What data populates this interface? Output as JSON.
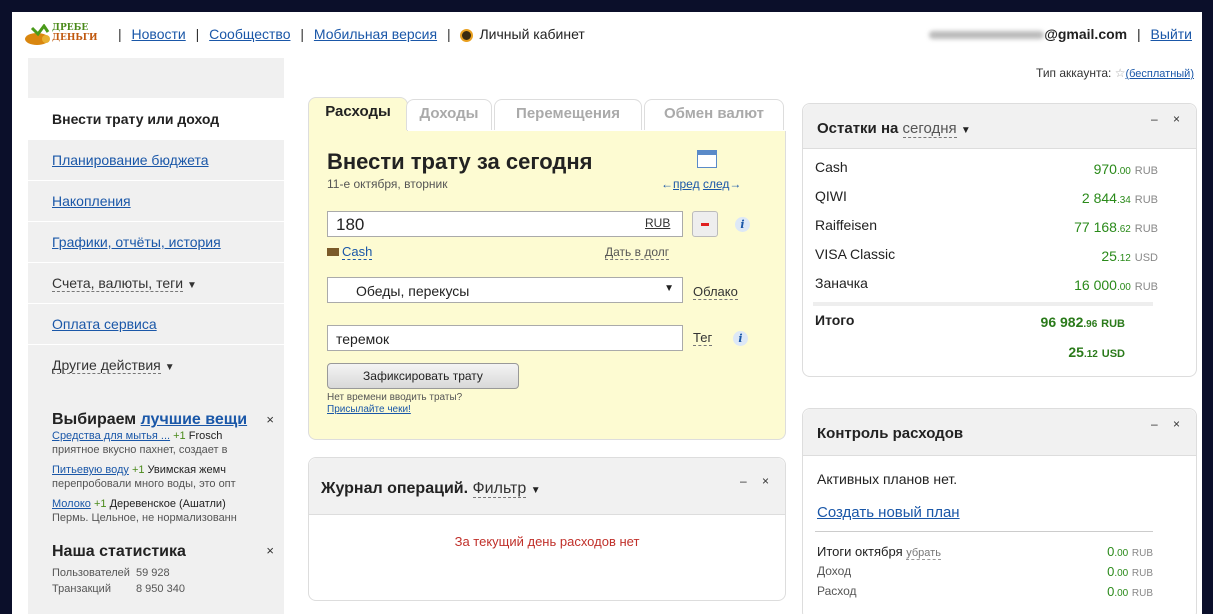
{
  "header": {
    "logo_line1": "ДРЕБЕ",
    "logo_line2": "ДЕНЬГИ",
    "nav": [
      "Новости",
      "Сообщество",
      "Мобильная версия"
    ],
    "cabinet": "Личный кабинет",
    "email": "@gmail.com",
    "logout": "Выйти"
  },
  "account": {
    "label": "Тип аккаунта:",
    "type": "(бесплатный)"
  },
  "sidebar": {
    "items": [
      {
        "label": "Внести трату или доход"
      },
      {
        "label": "Планирование бюджета"
      },
      {
        "label": "Накопления"
      },
      {
        "label": "Графики, отчёты, история"
      },
      {
        "label": "Счета, валюты, теги"
      },
      {
        "label": "Оплата сервиса"
      },
      {
        "label": "Другие действия"
      }
    ],
    "promo": {
      "title_prefix": "Выбираем",
      "title_link": "лучшие вещи",
      "close": "×",
      "entries": [
        {
          "link": "Средства для мытья ...",
          "plus": "+1",
          "text1": "Frosch",
          "text2": "приятное вкусно пахнет, создает в"
        },
        {
          "link": "Питьевую воду",
          "plus": "+1",
          "text1": "Увимская жемч",
          "text2": "перепробовали много воды, это опт"
        },
        {
          "link": "Молоко",
          "plus": "+1",
          "text1": "Деревенское (Ашатли)",
          "text2": "Пермь. Цельное, не нормализованн"
        }
      ]
    },
    "stats": {
      "title": "Наша статистика",
      "close": "×",
      "rows": [
        {
          "label": "Пользователей",
          "value": "59 928"
        },
        {
          "label": "Транзакций",
          "value": "8 950 340"
        }
      ]
    }
  },
  "entry": {
    "tabs": [
      "Расходы",
      "Доходы",
      "Перемещения",
      "Обмен валют"
    ],
    "title": "Внести трату за сегодня",
    "date": "11-е октября, вторник",
    "prev": "пред",
    "next": "след",
    "prev_arrow": "←",
    "next_arrow": "→",
    "amount": "180",
    "currency": "RUB",
    "wallet": "Cash",
    "debt": "Дать в долг",
    "category": "Обеды, перекусы",
    "cloud": "Облако",
    "tag_value": "теремок",
    "tag_label": "Тег",
    "submit": "Зафиксировать трату",
    "note1": "Нет времени вводить траты?",
    "note2": "Присылайте чеки!",
    "info": "i"
  },
  "journal": {
    "title": "Журнал операций.",
    "filter": "Фильтр",
    "empty": "За текущий день расходов нет",
    "controls": "– ×"
  },
  "balances": {
    "title": "Остатки на",
    "period": "сегодня",
    "controls": "– ×",
    "rows": [
      {
        "name": "Cash",
        "int": "970",
        "cents": ".00",
        "cur": "RUB"
      },
      {
        "name": "QIWI",
        "int": "2 844",
        "cents": ".34",
        "cur": "RUB"
      },
      {
        "name": "Raiffeisen",
        "int": "77 168",
        "cents": ".62",
        "cur": "RUB"
      },
      {
        "name": "VISA Classic",
        "int": "25",
        "cents": ".12",
        "cur": "USD"
      },
      {
        "name": "Заначка",
        "int": "16 000",
        "cents": ".00",
        "cur": "RUB"
      }
    ],
    "total_label": "Итого",
    "totals": [
      {
        "int": "96 982",
        "cents": ".96",
        "cur": "RUB"
      },
      {
        "int": "25",
        "cents": ".12",
        "cur": "USD"
      }
    ]
  },
  "control": {
    "title": "Контроль расходов",
    "controls": "– ×",
    "none": "Активных планов нет.",
    "create": "Создать новый план",
    "summary_label": "Итоги октября",
    "hide": "убрать",
    "rows": [
      {
        "name": "",
        "int": "0",
        "cents": ".00",
        "cur": "RUB"
      },
      {
        "name": "Доход",
        "int": "0",
        "cents": ".00",
        "cur": "RUB"
      },
      {
        "name": "Расход",
        "int": "0",
        "cents": ".00",
        "cur": "RUB"
      }
    ]
  }
}
